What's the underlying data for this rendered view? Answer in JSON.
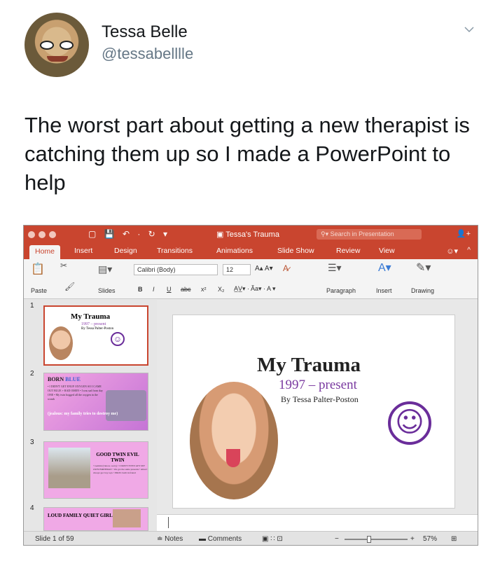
{
  "tweet": {
    "name": "Tessa Belle",
    "handle": "@tessabelllle",
    "text": "The worst part about getting a new therapist is catching them up so I made a PowerPoint to help"
  },
  "ppt": {
    "titlebar": {
      "doc_title": "Tessa's Trauma",
      "search_placeholder": "Search in Presentation"
    },
    "tabs": [
      "Home",
      "Insert",
      "Design",
      "Transitions",
      "Animations",
      "Slide Show",
      "Review",
      "View"
    ],
    "ribbon": {
      "paste": "Paste",
      "slides": "Slides",
      "font": "Calibri (Body)",
      "size": "12",
      "bold": "B",
      "italic": "I",
      "underline": "U",
      "strike": "abc",
      "superscript": "x²",
      "subscript": "X₂",
      "paragraph": "Paragraph",
      "insert": "Insert",
      "drawing": "Drawing"
    },
    "slides": [
      {
        "num": "1",
        "title": "My Trauma",
        "sub": "1997 – present",
        "by": "By Tessa Palter-Poston"
      },
      {
        "num": "2",
        "title_a": "BORN ",
        "title_b": "BLUE",
        "lines": "• I DIDN'T GET ENUF OXYGEN SO I CAME OUT BLUE + RAD OMEN • I was sad from day ONE • My twin hogged all the oxygen in the womb",
        "pink": "(jealous: my family tries to destroy me)"
      },
      {
        "num": "3",
        "title": "GOOD TWIN EVIL TWIN",
        "lines": "• Gemini (I know, sorry) • I DON'T EVEN GET MY OWN BIRTHDAY • We got the same presents • AKA I always got boy toys • PROS: built in friend"
      },
      {
        "num": "4",
        "title": "LOUD FAMILY QUIET GIRL"
      }
    ],
    "main_slide": {
      "title": "My Trauma",
      "subtitle": "1997 – present",
      "byline": "By Tessa Palter-Poston"
    },
    "statusbar": {
      "slide_count": "Slide 1 of 59",
      "notes": "Notes",
      "comments": "Comments",
      "zoom": "57%"
    }
  }
}
